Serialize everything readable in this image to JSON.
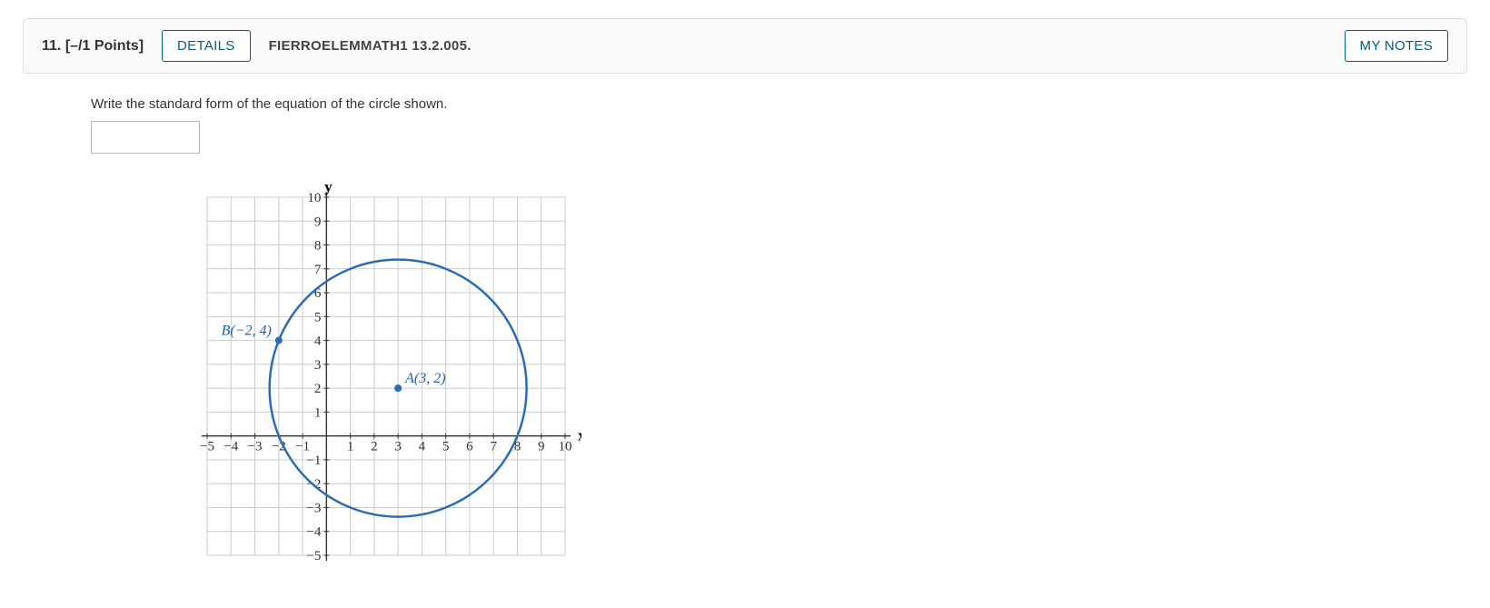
{
  "header": {
    "number": "11.",
    "points": "[–/1 Points]",
    "details": "DETAILS",
    "source": "FIERROELEMMATH1 13.2.005.",
    "notes": "MY NOTES"
  },
  "question": {
    "prompt": "Write the standard form of the equation of the circle shown.",
    "answer_value": ""
  },
  "chart_data": {
    "type": "scatter",
    "title": "",
    "xlabel": "x",
    "ylabel": "y",
    "xlim": [
      -5,
      10
    ],
    "ylim": [
      -5,
      10
    ],
    "xticks": [
      -5,
      -4,
      -3,
      -2,
      -1,
      1,
      2,
      3,
      4,
      5,
      6,
      7,
      8,
      9,
      10
    ],
    "yticks": [
      -5,
      -4,
      -3,
      -2,
      -1,
      1,
      2,
      3,
      4,
      5,
      6,
      7,
      8,
      9,
      10
    ],
    "points": [
      {
        "name": "A",
        "x": 3,
        "y": 2,
        "label": "A(3, 2)"
      },
      {
        "name": "B",
        "x": -2,
        "y": 4,
        "label": "B(−2, 4)"
      }
    ],
    "circle": {
      "cx": 3,
      "cy": 2,
      "r": 5.385
    }
  }
}
